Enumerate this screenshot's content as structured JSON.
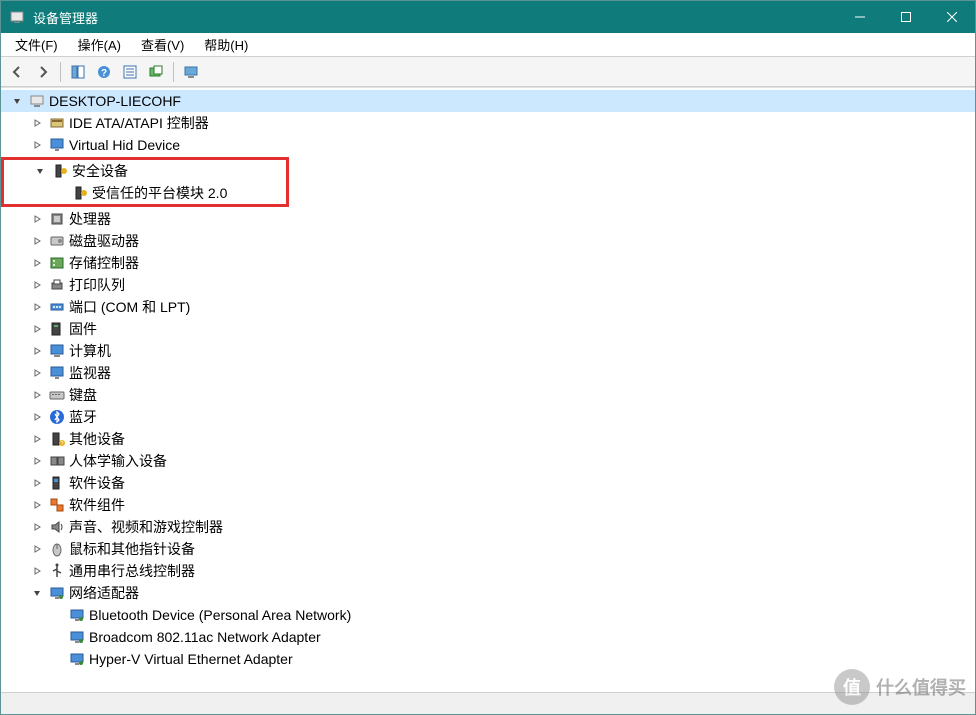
{
  "window": {
    "title": "设备管理器"
  },
  "menubar": {
    "file": "文件(F)",
    "action": "操作(A)",
    "view": "查看(V)",
    "help": "帮助(H)"
  },
  "tree": {
    "root": {
      "label": "DESKTOP-LIECOHF",
      "icon": "computer"
    },
    "items": [
      {
        "label": "IDE ATA/ATAPI 控制器",
        "icon": "ide",
        "expander": "collapsed",
        "indent": 1
      },
      {
        "label": "Virtual Hid Device",
        "icon": "monitor",
        "expander": "collapsed",
        "indent": 1
      },
      {
        "label": "安全设备",
        "icon": "security",
        "expander": "expanded",
        "indent": 1,
        "boxstart": true
      },
      {
        "label": "受信任的平台模块 2.0",
        "icon": "tpm",
        "expander": "none",
        "indent": 2,
        "boxend": true
      },
      {
        "label": "处理器",
        "icon": "cpu",
        "expander": "collapsed",
        "indent": 1
      },
      {
        "label": "磁盘驱动器",
        "icon": "disk",
        "expander": "collapsed",
        "indent": 1
      },
      {
        "label": "存储控制器",
        "icon": "storage",
        "expander": "collapsed",
        "indent": 1
      },
      {
        "label": "打印队列",
        "icon": "printer",
        "expander": "collapsed",
        "indent": 1
      },
      {
        "label": "端口 (COM 和 LPT)",
        "icon": "port",
        "expander": "collapsed",
        "indent": 1
      },
      {
        "label": "固件",
        "icon": "firmware",
        "expander": "collapsed",
        "indent": 1
      },
      {
        "label": "计算机",
        "icon": "pc",
        "expander": "collapsed",
        "indent": 1
      },
      {
        "label": "监视器",
        "icon": "monitor",
        "expander": "collapsed",
        "indent": 1
      },
      {
        "label": "键盘",
        "icon": "keyboard",
        "expander": "collapsed",
        "indent": 1
      },
      {
        "label": "蓝牙",
        "icon": "bluetooth",
        "expander": "collapsed",
        "indent": 1
      },
      {
        "label": "其他设备",
        "icon": "other",
        "expander": "collapsed",
        "indent": 1
      },
      {
        "label": "人体学输入设备",
        "icon": "hid",
        "expander": "collapsed",
        "indent": 1
      },
      {
        "label": "软件设备",
        "icon": "swdev",
        "expander": "collapsed",
        "indent": 1
      },
      {
        "label": "软件组件",
        "icon": "swcomp",
        "expander": "collapsed",
        "indent": 1
      },
      {
        "label": "声音、视频和游戏控制器",
        "icon": "audio",
        "expander": "collapsed",
        "indent": 1
      },
      {
        "label": "鼠标和其他指针设备",
        "icon": "mouse",
        "expander": "collapsed",
        "indent": 1
      },
      {
        "label": "通用串行总线控制器",
        "icon": "usb",
        "expander": "collapsed",
        "indent": 1
      },
      {
        "label": "网络适配器",
        "icon": "network",
        "expander": "expanded",
        "indent": 1
      },
      {
        "label": "Bluetooth Device (Personal Area Network)",
        "icon": "netadapter",
        "expander": "none",
        "indent": 2
      },
      {
        "label": "Broadcom 802.11ac Network Adapter",
        "icon": "netadapter",
        "expander": "none",
        "indent": 2
      },
      {
        "label": "Hyper-V Virtual Ethernet Adapter",
        "icon": "netadapter",
        "expander": "none",
        "indent": 2
      }
    ]
  },
  "watermark": {
    "badge": "值",
    "text": "什么值得买"
  }
}
